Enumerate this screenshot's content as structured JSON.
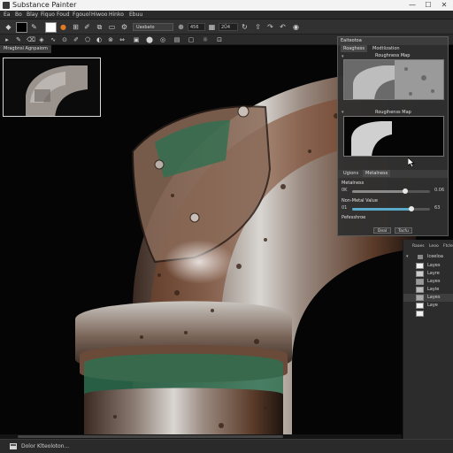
{
  "window": {
    "title": "Substance Painter",
    "minimize_label": "—",
    "maximize_label": "☐",
    "close_label": "✕"
  },
  "menu": {
    "items": [
      "Ea",
      "Bo",
      "Blay",
      "Fiquo",
      "Foud",
      "Fgouol",
      "Hiwoo",
      "Hinko",
      "Ebuu"
    ]
  },
  "toolbar": {
    "dropdown_value": "Uasbato",
    "field_a_value": "456",
    "field_b_value": "2Ü4"
  },
  "viewport": {
    "tab_label": "Mragbnsi Agnpaiom"
  },
  "properties_panel": {
    "header": "Eaiteotoa",
    "tabs": [
      "Roaghess",
      "Modtiization"
    ],
    "roughness_map_label": "Roughness Map",
    "roughness_map2_label": "Rougihenss Map",
    "sub_tabs": [
      "Ugions",
      "Metalness"
    ],
    "metalness_label": "Metalness",
    "metalness_min": "0K",
    "metalness_value": "0.06",
    "metalness_fraction": 0.68,
    "nonmetal_label": "Non-Metal Value",
    "nonmetal_min": "01",
    "nonmetal_value": "63",
    "nonmetal_fraction": 0.76,
    "extra_label": "Pefesshroe",
    "button_ok": "Deal",
    "button_apply": "Tacfu"
  },
  "layers_panel": {
    "tabs": [
      "Raoes",
      "Leoo",
      "Ftcle"
    ],
    "root_label": "Iceeloa",
    "layers": [
      "Layes",
      "Layre",
      "Layes",
      "Layie",
      "Layes",
      "Laye"
    ]
  },
  "statusbar": {
    "text": "Dolor Klteoloton..."
  },
  "colors": {
    "rust": "#8a4a2a",
    "metal": "#b5b5b5",
    "green_paint": "#2f6f50",
    "background": "#050505"
  }
}
